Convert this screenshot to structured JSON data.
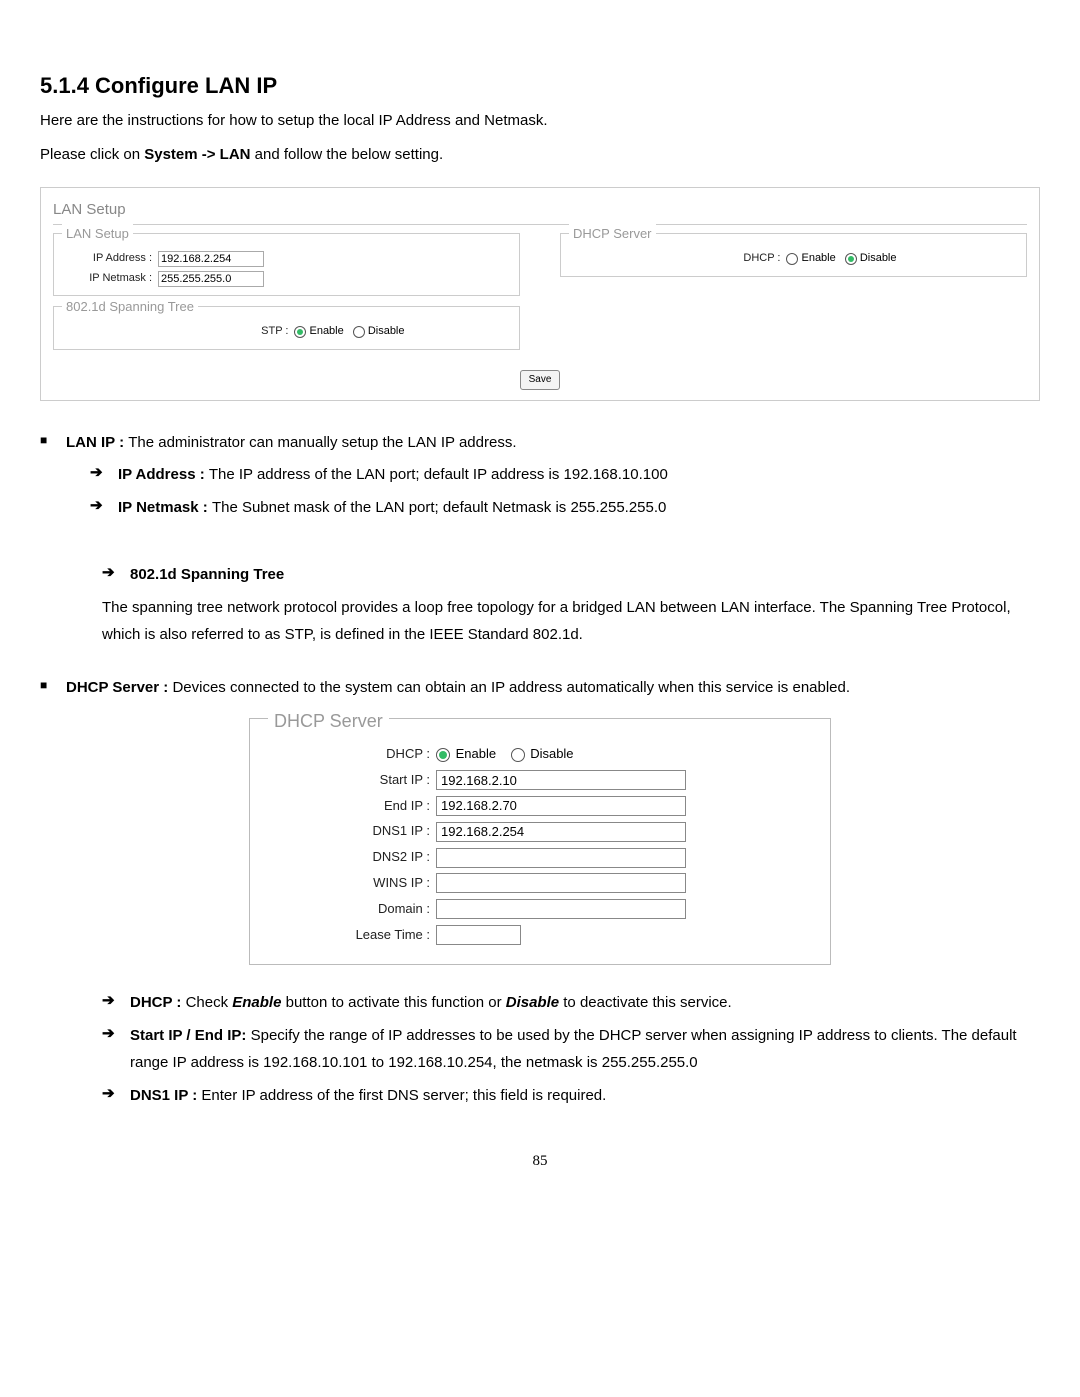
{
  "heading": "5.1.4 Configure LAN IP",
  "intro1": "Here are the instructions for how to setup the local IP Address and Netmask.",
  "intro2_pre": "Please click on ",
  "intro2_bold": "System -> LAN",
  "intro2_post": " and follow the below setting.",
  "panel1": {
    "title": "LAN Setup",
    "lan": {
      "legend": "LAN Setup",
      "ip_lbl": "IP Address :",
      "ip_val": "192.168.2.254",
      "nm_lbl": "IP Netmask :",
      "nm_val": "255.255.255.0"
    },
    "stp": {
      "legend": "802.1d Spanning Tree",
      "lbl": "STP :",
      "enable": "Enable",
      "disable": "Disable",
      "selected": "enable"
    },
    "dhcp": {
      "legend": "DHCP Server",
      "lbl": "DHCP :",
      "enable": "Enable",
      "disable": "Disable",
      "selected": "disable"
    },
    "save": "Save"
  },
  "b1": {
    "label": "LAN IP : ",
    "text": "The administrator can manually setup the LAN IP address."
  },
  "b1a": {
    "label": "IP Address : ",
    "text": "The IP address of the LAN port; default IP address is 192.168.10.100"
  },
  "b1b": {
    "label": "IP Netmask : ",
    "text": "The Subnet mask of the LAN port; default Netmask is 255.255.255.0"
  },
  "b2_label": "802.1d Spanning Tree",
  "b2_para": "The spanning tree network protocol provides a loop free topology for a bridged LAN between LAN interface. The Spanning Tree Protocol, which is also referred to as STP, is defined in the IEEE Standard 802.1d.",
  "b3": {
    "label": "DHCP Server : ",
    "text": "Devices connected to the system can obtain an IP address automatically when this service is enabled."
  },
  "panel2": {
    "legend": "DHCP Server",
    "dhcp_lbl": "DHCP :",
    "enable": "Enable",
    "disable": "Disable",
    "start_lbl": "Start IP :",
    "start_val": "192.168.2.10",
    "end_lbl": "End IP :",
    "end_val": "192.168.2.70",
    "dns1_lbl": "DNS1 IP :",
    "dns1_val": "192.168.2.254",
    "dns2_lbl": "DNS2 IP :",
    "dns2_val": "",
    "wins_lbl": "WINS IP :",
    "wins_val": "",
    "domain_lbl": "Domain :",
    "domain_val": "",
    "lease_lbl": "Lease Time :",
    "lease_val": ""
  },
  "b4": {
    "label": "DHCP :  ",
    "pre": "Check ",
    "en": "Enable",
    "mid": " button to activate this function or ",
    "dis": "Disable",
    "post": " to deactivate this service."
  },
  "b5": {
    "label": "Start IP / End IP: ",
    "text": "Specify the range of IP addresses to be used by the DHCP server when assigning IP address to clients. The default range IP address is 192.168.10.101 to 192.168.10.254, the netmask is 255.255.255.0"
  },
  "b6": {
    "label": "DNS1 IP :  ",
    "text": "Enter IP address of the first DNS server; this field is required."
  },
  "page_number": "85"
}
